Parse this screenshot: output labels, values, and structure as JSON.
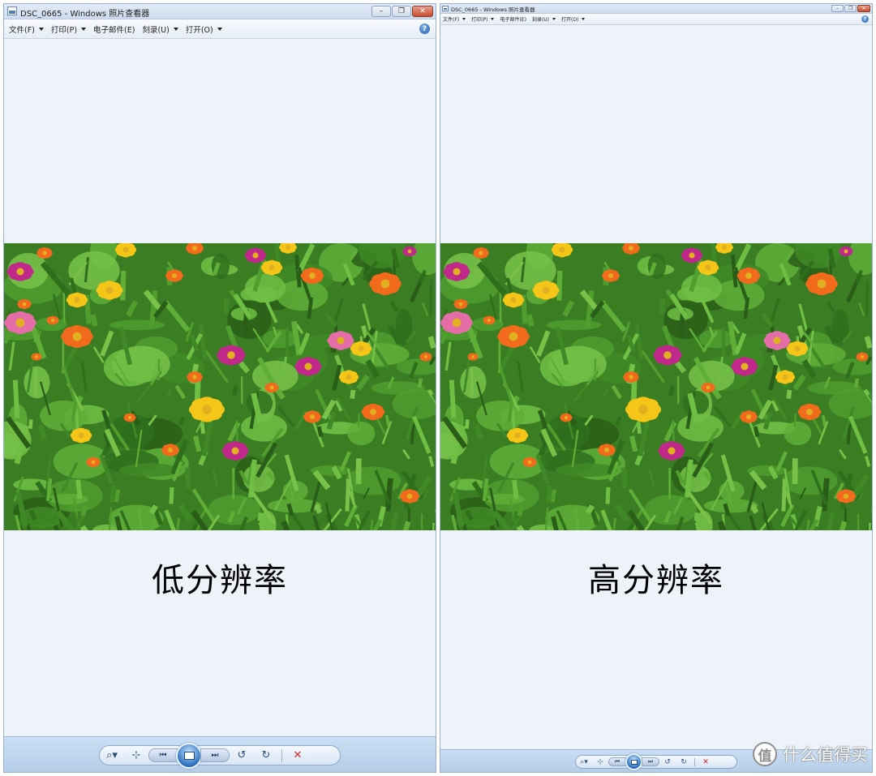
{
  "left_window": {
    "title": "DSC_0665 - Windows 照片查看器",
    "menu": [
      {
        "label": "文件(F)"
      },
      {
        "label": "打印(P)"
      },
      {
        "label": "电子邮件(E)"
      },
      {
        "label": "刻录(U)"
      },
      {
        "label": "打开(O)"
      }
    ],
    "help": "?",
    "caption": "低分辨率",
    "controls": {
      "zoom": "⌕▾",
      "actual_size": "⊹",
      "prev": "⏮",
      "next": "⏭",
      "rotate_ccw": "↺",
      "rotate_cw": "↻",
      "delete": "✕"
    }
  },
  "right_window": {
    "title": "DSC_0665 - Windows 照片查看器",
    "menu": [
      {
        "label": "文件(F)"
      },
      {
        "label": "打印(P)"
      },
      {
        "label": "电子邮件(E)"
      },
      {
        "label": "刻录(U)"
      },
      {
        "label": "打开(O)"
      }
    ],
    "help": "?",
    "caption": "高分辨率",
    "controls": {
      "zoom": "⌕▾",
      "actual_size": "⊹",
      "prev": "⏮",
      "next": "⏭",
      "rotate_ccw": "↺",
      "rotate_cw": "↻",
      "delete": "✕"
    }
  },
  "window_buttons": {
    "minimize": "–",
    "maximize": "❐",
    "close": "✕"
  },
  "watermark": {
    "logo": "值",
    "text": "什么值得买"
  },
  "colors": {
    "flower_orange": "#f26a1b",
    "flower_magenta": "#c0288a",
    "flower_yellow": "#f5c518",
    "flower_pink": "#e56da7",
    "foliage": "#3f8a26"
  }
}
